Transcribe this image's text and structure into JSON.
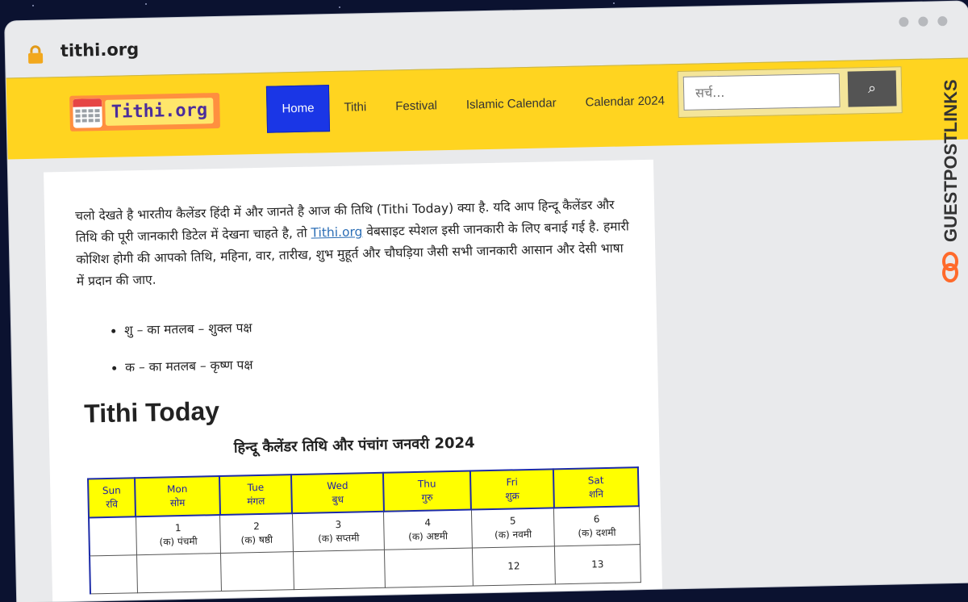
{
  "browser": {
    "url": "tithi.org"
  },
  "site": {
    "logo_text": "Tithi.org",
    "nav": [
      {
        "label": "Home"
      },
      {
        "label": "Tithi"
      },
      {
        "label": "Festival"
      },
      {
        "label": "Islamic Calendar"
      },
      {
        "label": "Calendar 2024"
      }
    ],
    "search": {
      "placeholder": "सर्च...",
      "button_icon": "search-icon"
    }
  },
  "article": {
    "intro_text": "चलो देखते है भारतीय कैलेंडर हिंदी में और जानते है आज की तिथि (Tithi Today) क्या है. यदि आप हिन्दू कैलेंडर और तिथि की पूरी जानकारी डिटेल में देखना चाहते है, तो ",
    "intro_link": "Tithi.org",
    "intro_text_2": " वेबसाइट स्पेशल इसी जानकारी के लिए बनाई गई है. हमारी कोशिश होगी की आपको तिथि, महिना, वार, तारीख, शुभ मुहूर्त और चौघड़िया जैसी सभी जानकारी आसान और देसी भाषा में प्रदान की जाए.",
    "bullets": [
      {
        "text": "शु – का मतलब – शुक्ल पक्ष"
      },
      {
        "text": "क – का मतलब – कृष्ण पक्ष"
      }
    ],
    "heading": "Tithi Today",
    "calendar_caption": "हिन्दू कैलेंडर तिथि और पंचांग जनवरी 2024"
  },
  "calendar": {
    "days": [
      {
        "en": "Sun",
        "hi": "रवि"
      },
      {
        "en": "Mon",
        "hi": "सोम"
      },
      {
        "en": "Tue",
        "hi": "मंगल"
      },
      {
        "en": "Wed",
        "hi": "बुध"
      },
      {
        "en": "Thu",
        "hi": "गुरु"
      },
      {
        "en": "Fri",
        "hi": "शुक्र"
      },
      {
        "en": "Sat",
        "hi": "शनि"
      }
    ],
    "week1": [
      {
        "date": "",
        "tithi": ""
      },
      {
        "date": "1",
        "tithi": "(क) पंचमी"
      },
      {
        "date": "2",
        "tithi": "(क) षष्ठी"
      },
      {
        "date": "3",
        "tithi": "(क) सप्तमी"
      },
      {
        "date": "4",
        "tithi": "(क) अष्टमी"
      },
      {
        "date": "5",
        "tithi": "(क) नवमी"
      },
      {
        "date": "6",
        "tithi": "(क) दशमी"
      }
    ],
    "week2_partial": [
      {
        "date": ""
      },
      {
        "date": ""
      },
      {
        "date": ""
      },
      {
        "date": ""
      },
      {
        "date": ""
      },
      {
        "date": "12"
      },
      {
        "date": "13"
      }
    ]
  },
  "watermark": {
    "text": "GUESTPOSTLINKS"
  }
}
